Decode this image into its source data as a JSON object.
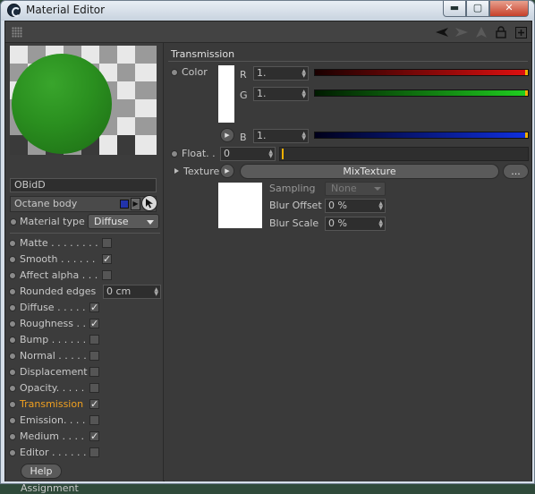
{
  "window": {
    "title": "Material Editor",
    "minimize": "▬",
    "maximize": "▢",
    "close": "✕"
  },
  "material": {
    "name": "OBidD",
    "type_row": "Octane body",
    "material_type_label": "Material type",
    "material_type_value": "Diffuse",
    "swatch_color": "#2233aa",
    "preview_color": "#2a8f1f"
  },
  "channels": [
    {
      "label": "Matte . . . . . . . .",
      "checked": false
    },
    {
      "label": "Smooth . . . . . .",
      "checked": true
    },
    {
      "label": "Affect alpha . . .",
      "checked": false
    },
    {
      "label": "Rounded edges",
      "value": "0 cm"
    },
    {
      "label": "Diffuse . . . . .",
      "checked": true
    },
    {
      "label": "Roughness . .",
      "checked": true
    },
    {
      "label": "Bump . . . . . .",
      "checked": false
    },
    {
      "label": "Normal . . . . .",
      "checked": false
    },
    {
      "label": "Displacement",
      "checked": false
    },
    {
      "label": "Opacity. . . . .",
      "checked": false
    },
    {
      "label": "Transmission",
      "checked": true,
      "active": true
    },
    {
      "label": "Emission. . . .",
      "checked": false
    },
    {
      "label": "Medium . . . .",
      "checked": true
    },
    {
      "label": "Editor . . . . . .",
      "checked": false
    }
  ],
  "left_footer": {
    "help": "Help",
    "assignment": "Assignment"
  },
  "transmission": {
    "title": "Transmission",
    "color_label": "Color",
    "r_label": "R",
    "r_value": "1.",
    "g_label": "G",
    "g_value": "1.",
    "b_label": "B",
    "b_value": "1.",
    "float_label": "Float. .",
    "float_value": "0",
    "texture_label": "Texture",
    "texture_value": "MixTexture",
    "more_button": "...",
    "sampling_label": "Sampling",
    "sampling_value": "None",
    "blur_offset_label": "Blur Offset",
    "blur_offset_value": "0 %",
    "blur_scale_label": "Blur Scale",
    "blur_scale_value": "0 %",
    "accent_color": "#f0b000"
  }
}
